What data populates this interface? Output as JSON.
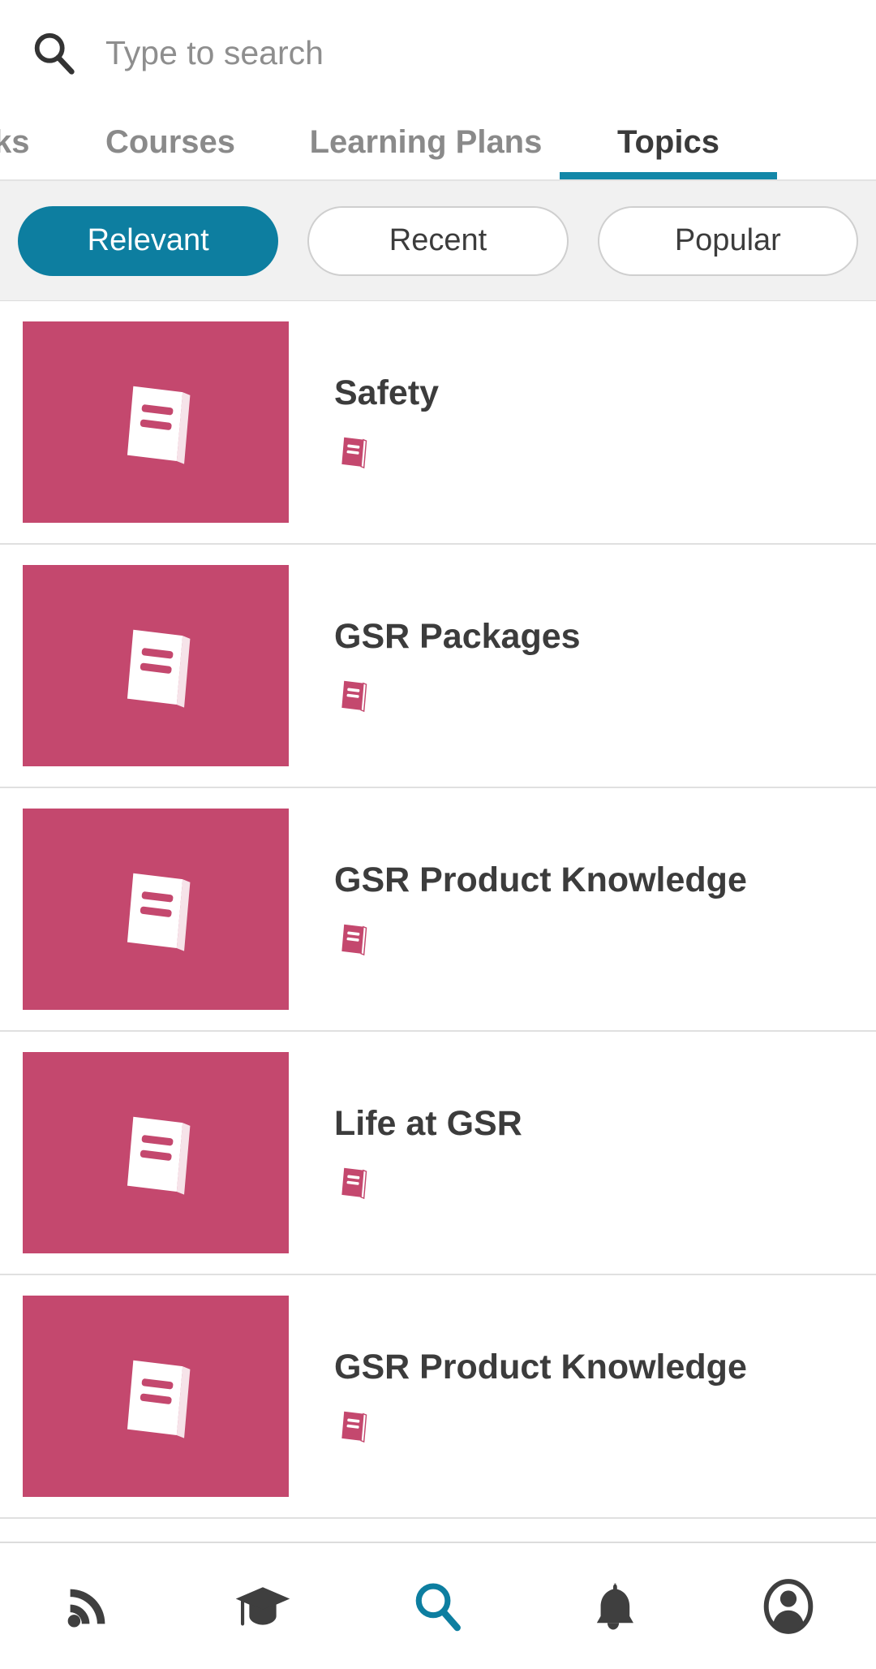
{
  "search": {
    "placeholder": "Type to search",
    "value": "",
    "icon": "search-icon"
  },
  "tabs": [
    {
      "label": "ks",
      "active": false,
      "clipped": true
    },
    {
      "label": "Courses",
      "active": false
    },
    {
      "label": "Learning Plans",
      "active": false
    },
    {
      "label": "Topics",
      "active": true
    }
  ],
  "filters": [
    {
      "label": "Relevant",
      "active": true
    },
    {
      "label": "Recent",
      "active": false
    },
    {
      "label": "Popular",
      "active": false
    }
  ],
  "topics": [
    {
      "title": "Safety",
      "thumb_icon": "book-icon",
      "badge_icon": "book-icon"
    },
    {
      "title": "GSR Packages",
      "thumb_icon": "book-icon",
      "badge_icon": "book-icon"
    },
    {
      "title": "GSR Product Knowledge",
      "thumb_icon": "book-icon",
      "badge_icon": "book-icon"
    },
    {
      "title": "Life at GSR",
      "thumb_icon": "book-icon",
      "badge_icon": "book-icon"
    },
    {
      "title": "GSR Product Knowledge",
      "thumb_icon": "book-icon",
      "badge_icon": "book-icon"
    }
  ],
  "bottom_nav": [
    {
      "name": "rss-feed-icon",
      "active": false
    },
    {
      "name": "graduation-cap-icon",
      "active": false
    },
    {
      "name": "search-icon",
      "active": true
    },
    {
      "name": "bell-icon",
      "active": false
    },
    {
      "name": "profile-icon",
      "active": false
    }
  ],
  "colors": {
    "accent_teal": "#0d7ea0",
    "tab_underline": "#1387a8",
    "thumb_pink": "#c4486e",
    "filterbar_bg": "#f1f1f1",
    "text_dark": "#3c3c3c",
    "text_muted": "#8a8a8a",
    "divider": "#e0e0e0"
  }
}
